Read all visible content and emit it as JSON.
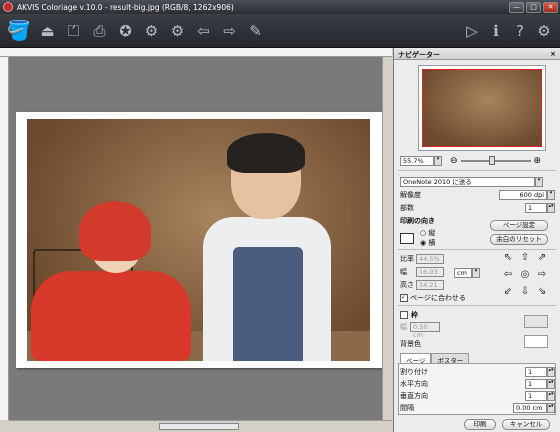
{
  "title": "AKVIS Coloriage v.10.0 - result-big.jpg (RGB/8, 1262x906)",
  "window": {
    "minimize": "—",
    "maximize": "□",
    "close": "✕"
  },
  "toolbar": {
    "icons": [
      "bucket-icon",
      "open-icon",
      "export-icon",
      "print-icon",
      "share-icon",
      "settings-gear-icon",
      "settings-gear-icon",
      "back-arrow-icon",
      "forward-arrow-icon",
      "eraser-icon"
    ],
    "right_icons": [
      "run-icon",
      "info-icon",
      "help-icon",
      "preferences-icon"
    ]
  },
  "navigator": {
    "title": "ナビゲーター",
    "zoom": "55.7%"
  },
  "print": {
    "printer": "OneNote 2010 に送る",
    "resolution_label": "解像度",
    "resolution": "600 dpi",
    "copies_label": "部数",
    "copies": "1",
    "orientation_label": "印刷の向き",
    "portrait": "縦",
    "landscape": "横",
    "page_setup": "ページ設定",
    "reset_margins": "余白のリセット",
    "scale_label": "比率",
    "scale": "44.5%",
    "width_label": "幅",
    "width": "16.03",
    "height_label": "高さ",
    "height": "14.21",
    "unit": "cm",
    "fit_page": "ページに合わせる"
  },
  "frame": {
    "label": "枠",
    "width_label": "幅",
    "width": "0.50 cm"
  },
  "background": {
    "label": "背景色"
  },
  "tabs": [
    "ページ",
    "ポスター"
  ],
  "layout": {
    "pages_label": "割り付け",
    "pages": "1",
    "horizontal_label": "水平方向",
    "horizontal": "1",
    "vertical_label": "垂直方向",
    "vertical": "1",
    "spacing_label": "間隔",
    "spacing": "0.00 cm"
  },
  "buttons": {
    "print": "印刷",
    "cancel": "キャンセル"
  }
}
